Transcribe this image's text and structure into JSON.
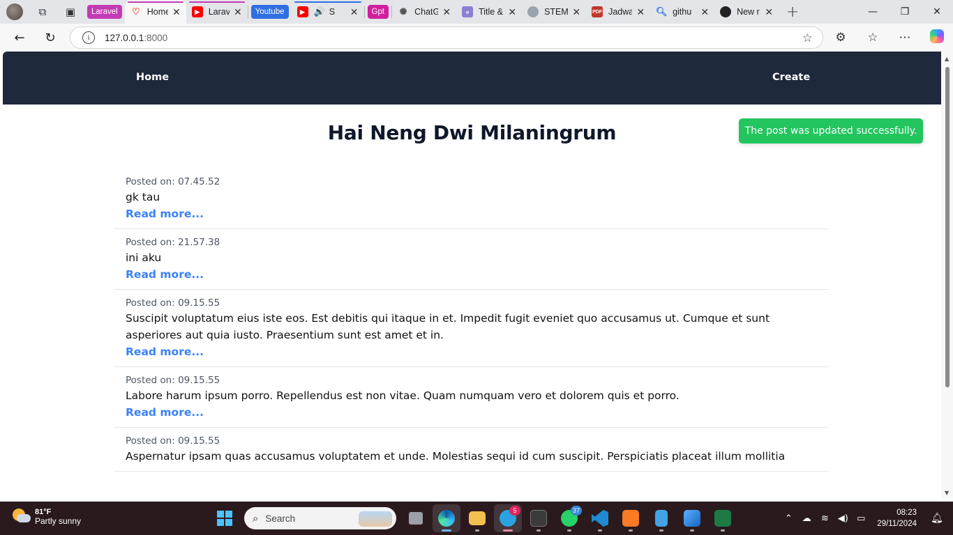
{
  "browser": {
    "tab_groups": [
      {
        "label": "Laravel",
        "color": "#c33bb4"
      },
      {
        "label": "Youtube",
        "color": "#2f6fe4"
      },
      {
        "label": "Gpt",
        "color": "#d11fa0"
      }
    ],
    "tabs": [
      {
        "label": "Home",
        "active": true
      },
      {
        "label": "Larave"
      },
      {
        "label": "S"
      },
      {
        "label": "ChatG"
      },
      {
        "label": "Title &"
      },
      {
        "label": "STEM"
      },
      {
        "label": "Jadwa"
      },
      {
        "label": "githu"
      },
      {
        "label": "New r"
      }
    ],
    "url_host": "127.0.0.1",
    "url_port": ":8000"
  },
  "site": {
    "nav": {
      "home": "Home",
      "create": "Create"
    },
    "title": "Hai Neng Dwi Milaningrum",
    "toast": "The post was updated successfully.",
    "read_more": "Read more...",
    "posts": [
      {
        "posted_on": "Posted on: 07.45.52",
        "title": "gk tau"
      },
      {
        "posted_on": "Posted on: 21.57.38",
        "title": "ini aku"
      },
      {
        "posted_on": "Posted on: 09.15.55",
        "title": "Suscipit voluptatum eius iste eos. Est debitis qui itaque in et. Impedit fugit eveniet quo accusamus ut. Cumque et sunt asperiores aut quia iusto. Praesentium sunt est amet et in."
      },
      {
        "posted_on": "Posted on: 09.15.55",
        "title": "Labore harum ipsum porro. Repellendus est non vitae. Quam numquam vero et dolorem quis et porro."
      },
      {
        "posted_on": "Posted on: 09.15.55",
        "title": "Aspernatur ipsam quas accusamus voluptatem et unde. Molestias sequi id cum suscipit. Perspiciatis placeat illum mollitia"
      }
    ]
  },
  "taskbar": {
    "weather_temp": "81°F",
    "weather_desc": "Partly sunny",
    "search_placeholder": "Search",
    "telegram_badge": "5",
    "whatsapp_badge": "37",
    "time": "08:23",
    "date": "29/11/2024"
  },
  "colors": {
    "nav_bg": "#1e293b",
    "toast_bg": "#22c55e",
    "link": "#3b82f6"
  }
}
